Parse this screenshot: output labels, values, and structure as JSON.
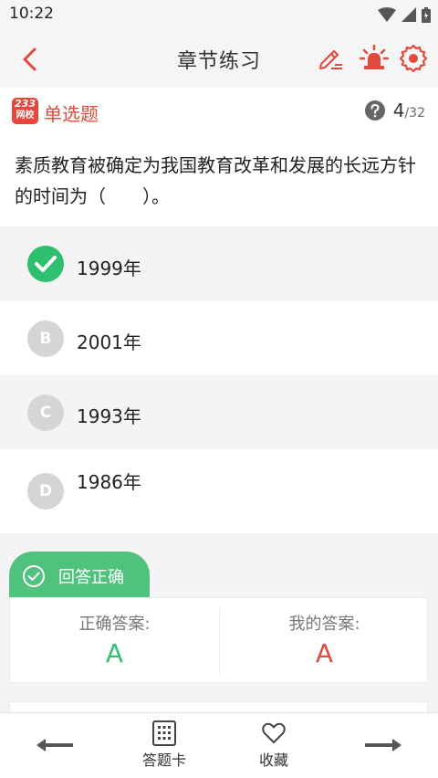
{
  "status_bar": {
    "time": "10:22"
  },
  "header": {
    "title": "章节练习"
  },
  "question_type": {
    "logo_number": "233",
    "logo_text": "网校",
    "label": "单选题",
    "current": "4",
    "total": "/32"
  },
  "question": {
    "text": "素质教育被确定为我国教育改革和发展的长远方针的时间为（　　）。"
  },
  "options": [
    {
      "letter": "A",
      "text": "1999年",
      "state": "correct"
    },
    {
      "letter": "B",
      "text": "2001年",
      "state": "normal"
    },
    {
      "letter": "C",
      "text": "1993年",
      "state": "normal"
    },
    {
      "letter": "D",
      "text": "1986年",
      "state": "normal"
    }
  ],
  "result": {
    "status": "回答正确",
    "correct_label": "正确答案:",
    "correct_value": "A",
    "my_label": "我的答案:",
    "my_value": "A"
  },
  "bottom_nav": {
    "answer_card": "答题卡",
    "favorite": "收藏"
  },
  "colors": {
    "accent_red": "#e04a3c",
    "correct_green": "#2fbf71",
    "tab_green": "#4fc37d"
  }
}
